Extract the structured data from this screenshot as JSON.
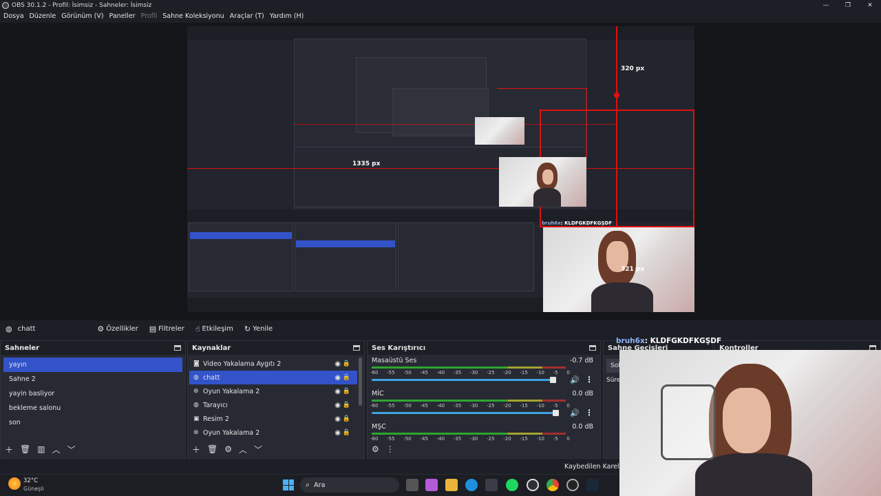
{
  "window": {
    "title": "OBS 30.1.2 - Profil: İsimsiz - Sahneler: İsimsiz",
    "min": "—",
    "max": "❐",
    "close": "✕"
  },
  "menu": [
    {
      "label": "Dosya",
      "disabled": false
    },
    {
      "label": "Düzenle",
      "disabled": false
    },
    {
      "label": "Görünüm (V)",
      "disabled": false
    },
    {
      "label": "Paneller",
      "disabled": false
    },
    {
      "label": "Profil",
      "disabled": true
    },
    {
      "label": "Sahne Koleksiyonu",
      "disabled": false
    },
    {
      "label": "Araçlar (T)",
      "disabled": false
    },
    {
      "label": "Yardım (H)",
      "disabled": false
    }
  ],
  "preview": {
    "labels": {
      "px320": "320 px",
      "px1335": "1335 px",
      "px321": "321 px"
    },
    "chat_name": "bruh6x",
    "chat_msg": ": KLDFGKDFKGŞDF"
  },
  "source_toolbar": {
    "selected_source": "chatt",
    "properties": "Özellikler",
    "filters": "Filtreler",
    "interact": "Etkileşim",
    "refresh": "Yenile"
  },
  "scenes": {
    "title": "Sahneler",
    "items": [
      "yayın",
      "Sahne 2",
      "yayin basliyor",
      "bekleme salonu",
      "son"
    ],
    "selected": 0
  },
  "sources": {
    "title": "Kaynaklar",
    "items": [
      {
        "name": "Video Yakalama Aygıtı 2",
        "icon": "camera-icon"
      },
      {
        "name": "chatt",
        "icon": "globe-icon"
      },
      {
        "name": "Oyun Yakalama 2",
        "icon": "gamepad-icon"
      },
      {
        "name": "Tarayıcı",
        "icon": "globe-icon"
      },
      {
        "name": "Resim 2",
        "icon": "image-icon"
      },
      {
        "name": "Oyun Yakalama 2",
        "icon": "gamepad-icon"
      }
    ],
    "selected": 1
  },
  "mixer": {
    "title": "Ses Karıştırıcı",
    "ticks": [
      "-60",
      "-55",
      "-50",
      "-45",
      "-40",
      "-35",
      "-30",
      "-25",
      "-20",
      "-15",
      "-10",
      "-5",
      "0"
    ],
    "channels": [
      {
        "name": "Masaüstü Ses",
        "db": "-0.7 dB",
        "level": 0.96
      },
      {
        "name": "MİC",
        "db": "0.0 dB",
        "level": 0.98
      },
      {
        "name": "MŞC",
        "db": "0.0 dB",
        "level": 0.98
      }
    ]
  },
  "transitions": {
    "title": "Sahne Geçişleri",
    "row1": "Sol",
    "row2": "Süre"
  },
  "controls": {
    "title": "Kontroller"
  },
  "status": {
    "dropped": "Kaybedilen Kareler 0"
  },
  "taskbar": {
    "weather_temp": "32°C",
    "weather_desc": "Güneşli",
    "search": "Ara"
  },
  "overlay": {
    "name": "bruh6x",
    "msg": ": KLDFGKDFKGŞDF"
  },
  "colors": {
    "accent": "#3253c9",
    "red_guides": "#e01010",
    "meter_green": "#2fa52f"
  }
}
